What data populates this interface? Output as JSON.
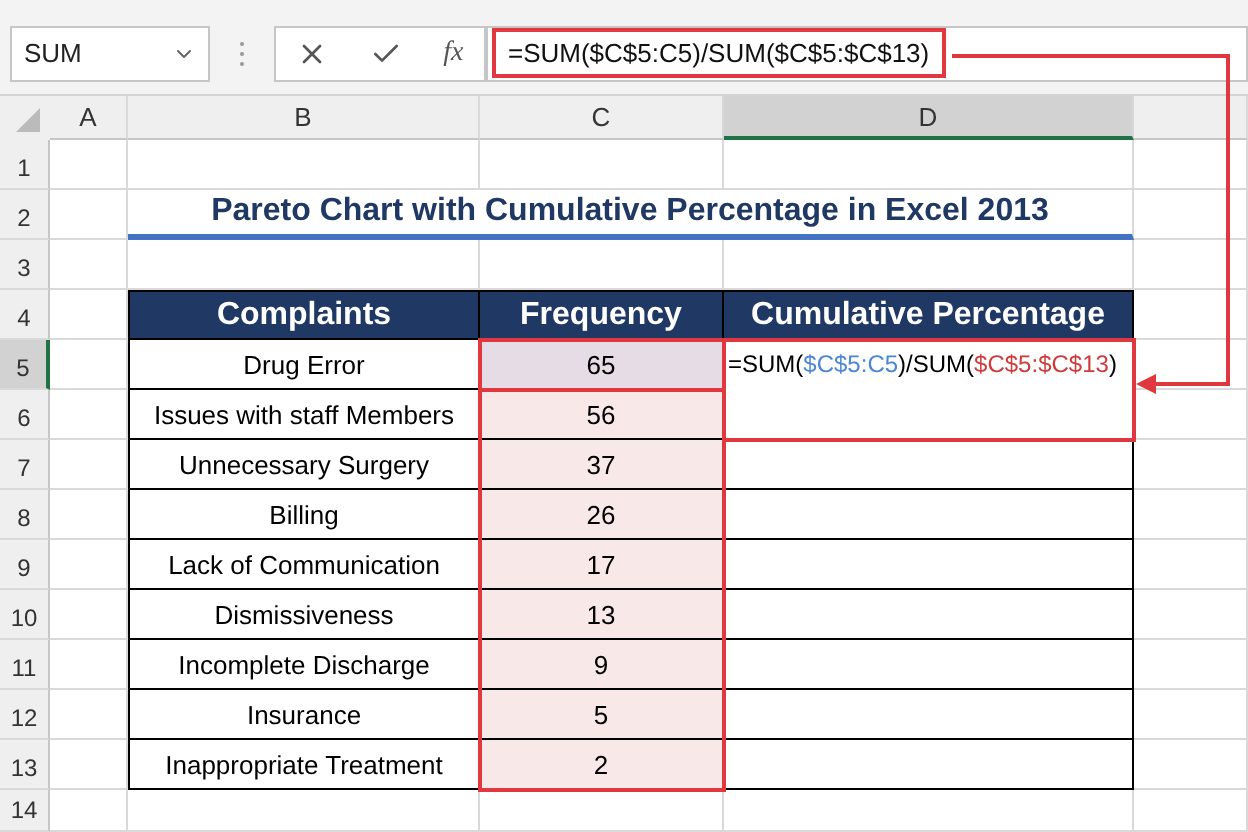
{
  "name_box": {
    "value": "SUM"
  },
  "formula_bar": {
    "function_label": "fx",
    "formula": "=SUM($C$5:C5)/SUM($C$5:$C$13)",
    "framed": true
  },
  "column_headers": [
    {
      "label": "A",
      "selected": false
    },
    {
      "label": "B",
      "selected": false
    },
    {
      "label": "C",
      "selected": false
    },
    {
      "label": "D",
      "selected": true
    }
  ],
  "row_headers": [
    {
      "label": "1",
      "selected": false
    },
    {
      "label": "2",
      "selected": false
    },
    {
      "label": "3",
      "selected": false
    },
    {
      "label": "4",
      "selected": false
    },
    {
      "label": "5",
      "selected": true
    },
    {
      "label": "6",
      "selected": false
    },
    {
      "label": "7",
      "selected": false
    },
    {
      "label": "8",
      "selected": false
    },
    {
      "label": "9",
      "selected": false
    },
    {
      "label": "10",
      "selected": false
    },
    {
      "label": "11",
      "selected": false
    },
    {
      "label": "12",
      "selected": false
    },
    {
      "label": "13",
      "selected": false
    },
    {
      "label": "14",
      "selected": false
    }
  ],
  "title": "Pareto Chart with Cumulative Percentage in Excel 2013",
  "table": {
    "columns": [
      "Complaints",
      "Frequency",
      "Cumulative Percentage"
    ],
    "rows": [
      {
        "complaint": "Drug Error",
        "frequency": "65",
        "selected": true,
        "cumulative": [
          {
            "text": "=SUM(",
            "color": "#000000"
          },
          {
            "text": "$C$5:C5",
            "color": "#4a86d4"
          },
          {
            "text": ")/SUM(",
            "color": "#000000"
          },
          {
            "text": "$C$5:$C$13",
            "color": "#d03a3a"
          },
          {
            "text": ")",
            "color": "#000000"
          }
        ]
      },
      {
        "complaint": "Issues with staff Members",
        "frequency": "56",
        "selected": false
      },
      {
        "complaint": "Unnecessary Surgery",
        "frequency": "37",
        "selected": false
      },
      {
        "complaint": "Billing",
        "frequency": "26",
        "selected": false
      },
      {
        "complaint": "Lack of Communication",
        "frequency": "17",
        "selected": false
      },
      {
        "complaint": "Dismissiveness",
        "frequency": "13",
        "selected": false
      },
      {
        "complaint": "Incomplete Discharge",
        "frequency": "9",
        "selected": false
      },
      {
        "complaint": "Insurance",
        "frequency": "5",
        "selected": false
      },
      {
        "complaint": "Inappropriate Treatment",
        "frequency": "2",
        "selected": false
      }
    ]
  },
  "callout": {
    "target_frame": true,
    "range_frames": true,
    "arrow": true
  }
}
